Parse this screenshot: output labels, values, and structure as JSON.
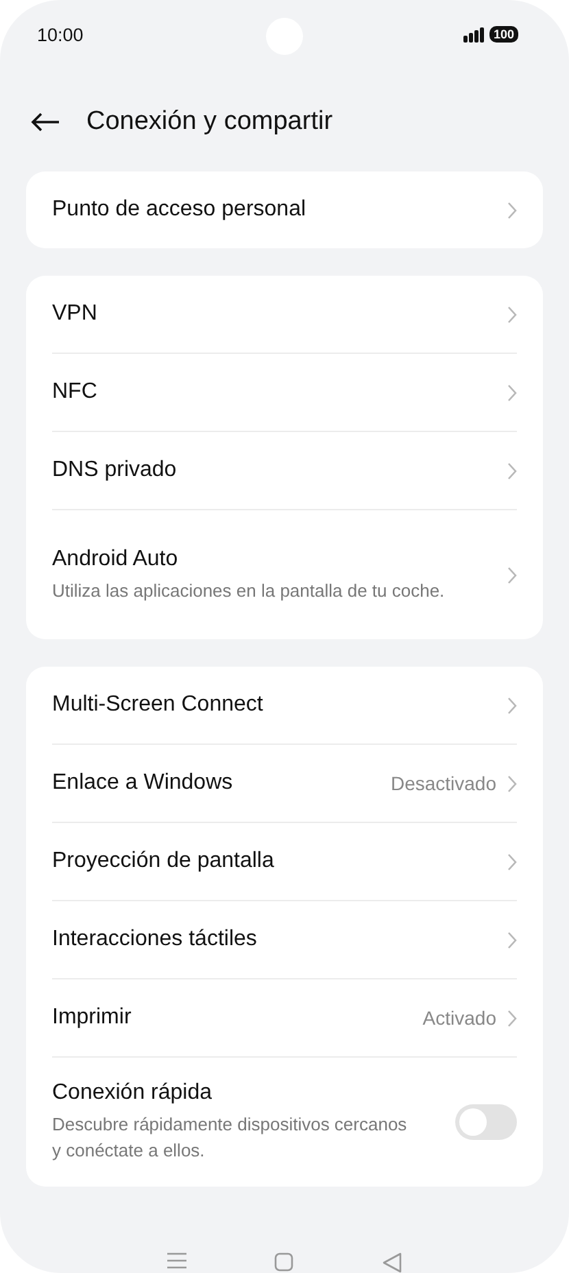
{
  "status_bar": {
    "time": "10:00",
    "battery": "100"
  },
  "header": {
    "title": "Conexión y compartir"
  },
  "groups": [
    {
      "items": [
        {
          "kind": "link",
          "label": "Punto de acceso personal"
        }
      ]
    },
    {
      "items": [
        {
          "kind": "link",
          "label": "VPN"
        },
        {
          "kind": "link",
          "label": "NFC"
        },
        {
          "kind": "link",
          "label": "DNS privado"
        },
        {
          "kind": "link",
          "label": "Android Auto",
          "description": "Utiliza las aplicaciones en la pantalla de tu coche."
        }
      ]
    },
    {
      "items": [
        {
          "kind": "link",
          "label": "Multi-Screen Connect"
        },
        {
          "kind": "link",
          "label": "Enlace a Windows",
          "value": "Desactivado"
        },
        {
          "kind": "link",
          "label": "Proyección de pantalla"
        },
        {
          "kind": "link",
          "label": "Interacciones táctiles"
        },
        {
          "kind": "link",
          "label": "Imprimir",
          "value": "Activado"
        },
        {
          "kind": "toggle",
          "label": "Conexión rápida",
          "description": "Descubre rápidamente dispositivos cercanos y conéctate a ellos.",
          "on": false
        }
      ]
    }
  ]
}
